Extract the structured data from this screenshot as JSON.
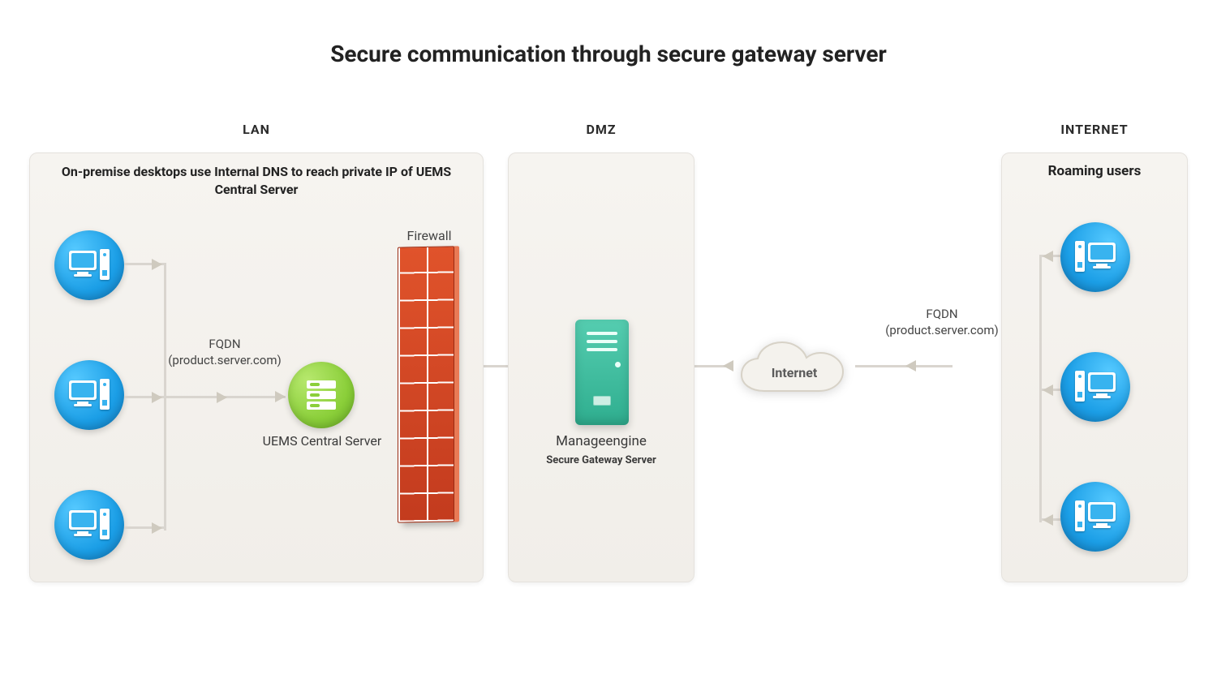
{
  "title": "Secure communication through secure gateway server",
  "zones": {
    "lan": "LAN",
    "dmz": "DMZ",
    "internet": "INTERNET"
  },
  "lan": {
    "subtitle": "On-premise desktops use Internal DNS to reach private IP of UEMS Central Server",
    "fqdn_label": "FQDN",
    "fqdn_value": "(product.server.com)",
    "server_label": "UEMS Central Server",
    "firewall_label": "Firewall"
  },
  "dmz": {
    "gateway_line1": "Manageengine",
    "gateway_line2": "Secure Gateway Server"
  },
  "cloud": {
    "label": "Internet"
  },
  "net": {
    "subtitle": "Roaming users",
    "fqdn_label": "FQDN",
    "fqdn_value": "(product.server.com)"
  }
}
